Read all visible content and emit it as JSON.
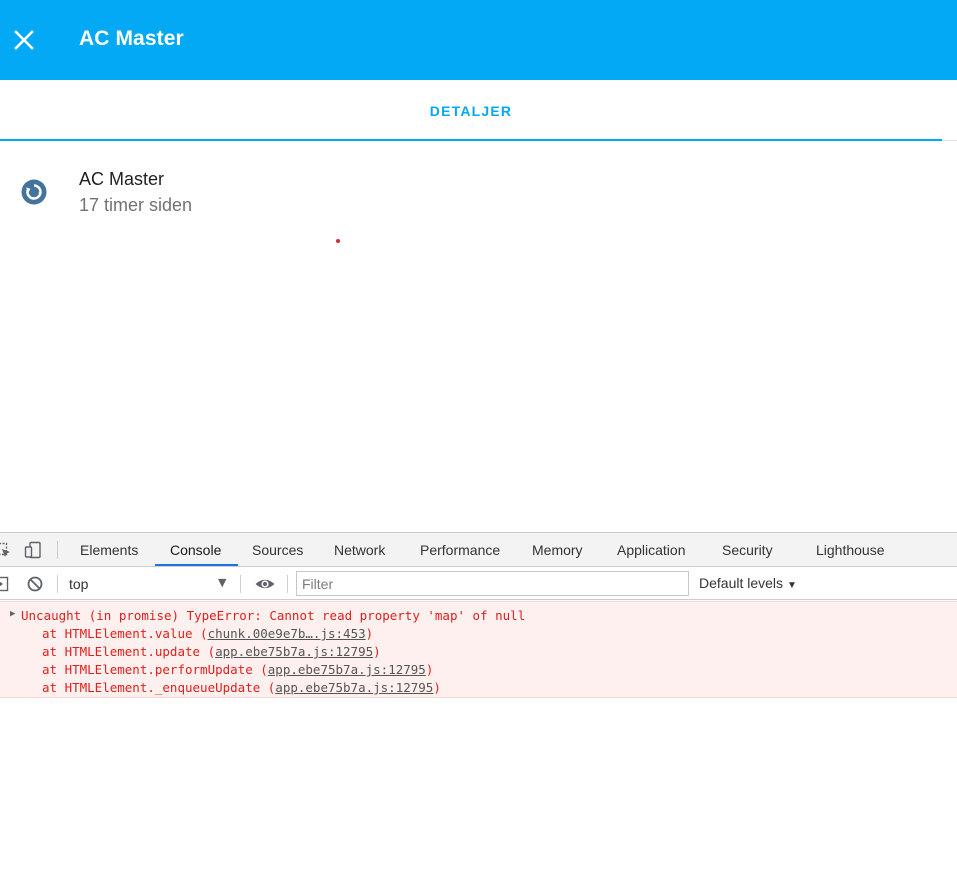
{
  "header": {
    "title": "AC Master",
    "background": "#03a9f4"
  },
  "tabs": [
    {
      "label": "DETALJER",
      "active": true
    }
  ],
  "entity": {
    "name": "AC Master",
    "last_changed": "17 timer siden",
    "icon": "sync-circle-icon",
    "icon_color": "#44739e"
  },
  "devtools": {
    "tabs": [
      "Elements",
      "Console",
      "Sources",
      "Network",
      "Performance",
      "Memory",
      "Application",
      "Security",
      "Lighthouse"
    ],
    "active_tab": "Console",
    "context": "top",
    "filter_placeholder": "Filter",
    "levels_label": "Default levels",
    "error": {
      "message": "Uncaught (in promise) TypeError: Cannot read property 'map' of null",
      "stack": [
        {
          "prefix": "at HTMLElement.value (",
          "link": "chunk.00e9e7b….js:453",
          "suffix": ")"
        },
        {
          "prefix": "at HTMLElement.update (",
          "link": "app.ebe75b7a.js:12795",
          "suffix": ")"
        },
        {
          "prefix": "at HTMLElement.performUpdate (",
          "link": "app.ebe75b7a.js:12795",
          "suffix": ")"
        },
        {
          "prefix": "at HTMLElement._enqueueUpdate (",
          "link": "app.ebe75b7a.js:12795",
          "suffix": ")"
        }
      ]
    }
  }
}
